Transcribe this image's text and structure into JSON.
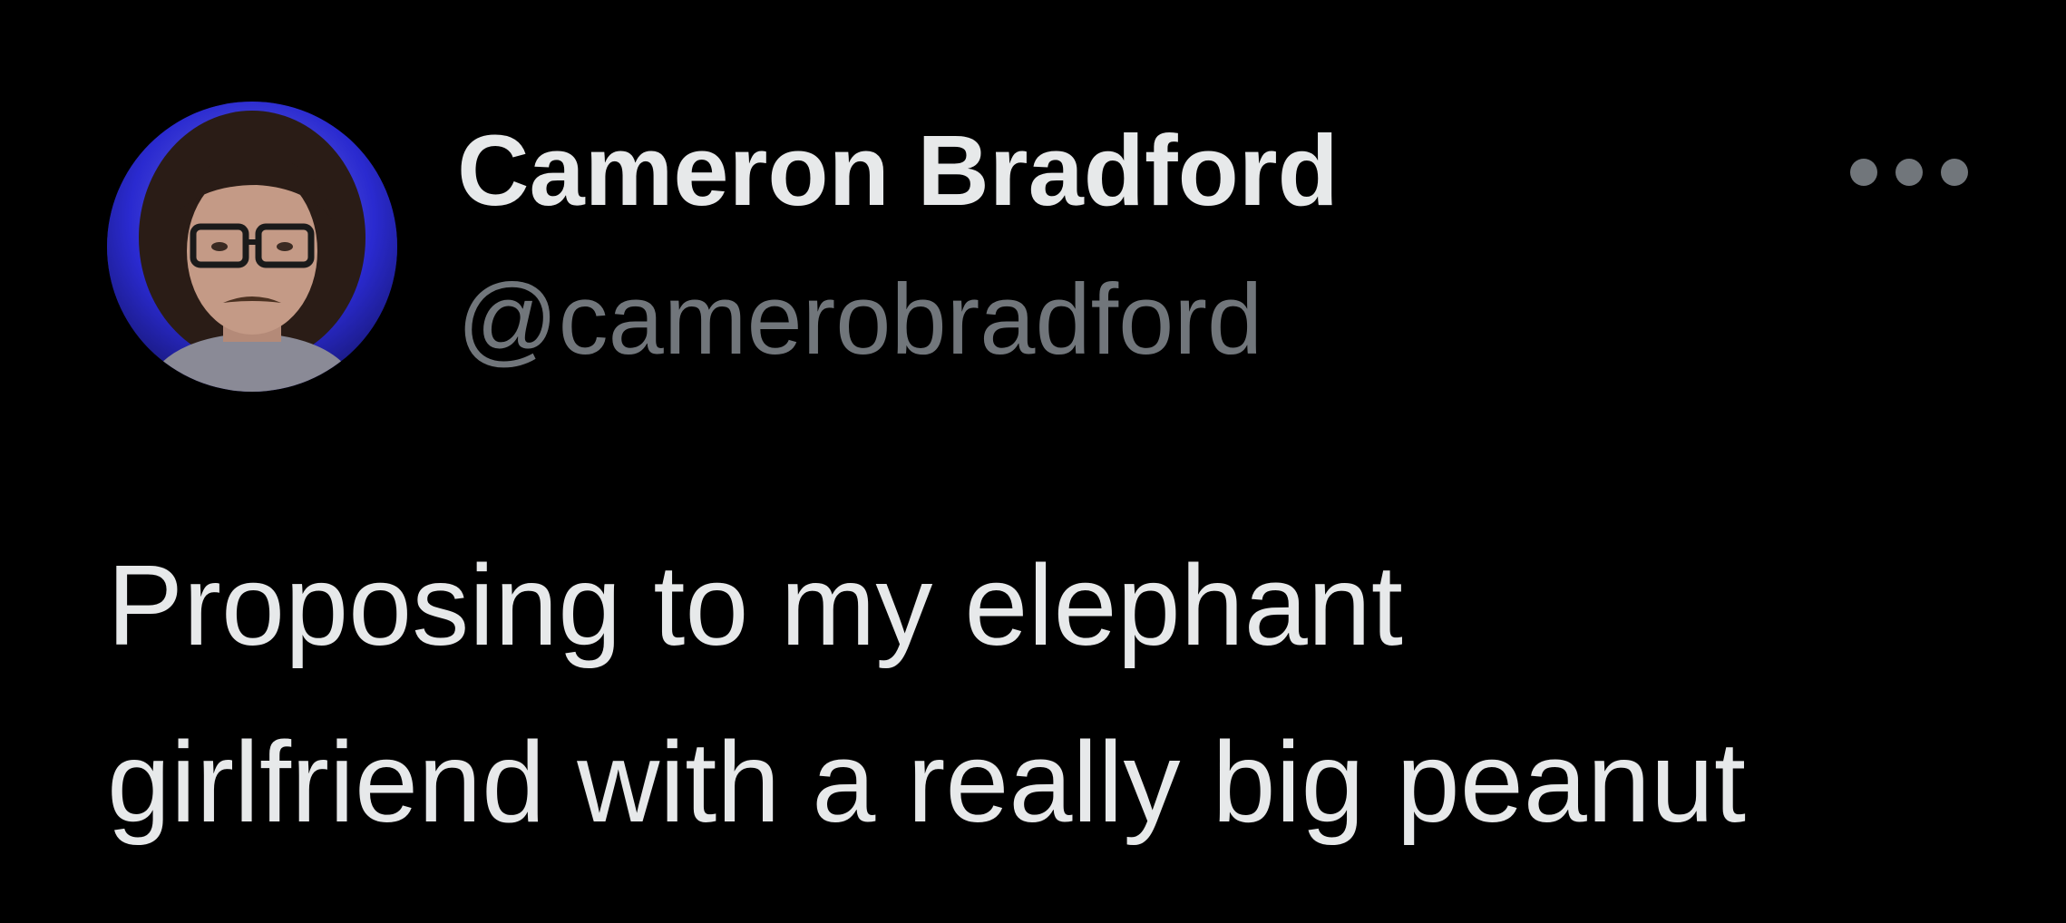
{
  "tweet": {
    "author": {
      "display_name": "Cameron Bradford",
      "handle": "@camerobradford",
      "avatar_icon": "avatar-photo"
    },
    "more_icon": "more-horizontal-icon",
    "text_lines": [
      "Proposing to my elephant",
      "girlfriend with a really big peanut"
    ]
  },
  "colors": {
    "background": "#000000",
    "primary_text": "#e7e9ea",
    "secondary_text": "#71767b"
  }
}
